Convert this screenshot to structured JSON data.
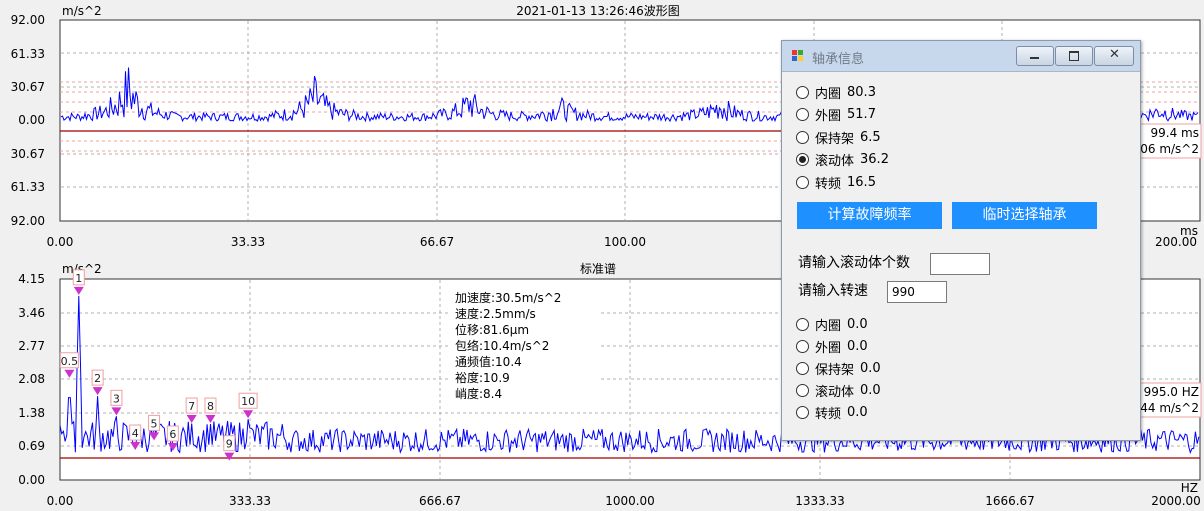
{
  "waveform": {
    "title": "2021-01-13  13:26:46波形图",
    "unit_y": "m/s^2",
    "unit_x": "ms",
    "y_ticks": [
      "92.00",
      "61.33",
      "30.67",
      "0.00",
      "30.67",
      "61.33",
      "92.00"
    ],
    "x_ticks": [
      "0.00",
      "33.33",
      "66.67",
      "100.00",
      "200.00"
    ],
    "cursor_time": "99.4 ms",
    "cursor_value": "06 m/s^2",
    "colors": {
      "signal": "#0000ff",
      "baseline": "#a00000",
      "grid": "#b0b0b0"
    }
  },
  "spectrum": {
    "title": "标准谱",
    "unit_y": "m/s^2",
    "unit_x": "HZ",
    "y_ticks": [
      "4.15",
      "3.46",
      "2.77",
      "2.08",
      "1.38",
      "0.69",
      "0.00"
    ],
    "x_ticks": [
      "0.00",
      "333.33",
      "666.67",
      "1000.00",
      "1333.33",
      "1666.67",
      "2000.00"
    ],
    "cursor_freq": "995.0 HZ",
    "cursor_value": "44 m/s^2",
    "markers": [
      {
        "label": "0.5",
        "freq": 16.5,
        "amp": 2.08
      },
      {
        "label": "1",
        "freq": 33,
        "amp": 3.8
      },
      {
        "label": "2",
        "freq": 66,
        "amp": 1.72
      },
      {
        "label": "3",
        "freq": 99,
        "amp": 1.3
      },
      {
        "label": "4",
        "freq": 132,
        "amp": 0.58
      },
      {
        "label": "5",
        "freq": 165,
        "amp": 0.78
      },
      {
        "label": "6",
        "freq": 198,
        "amp": 0.56
      },
      {
        "label": "7",
        "freq": 231,
        "amp": 1.14
      },
      {
        "label": "8",
        "freq": 264,
        "amp": 1.14
      },
      {
        "label": "9",
        "freq": 297,
        "amp": 0.36
      },
      {
        "label": "10",
        "freq": 330,
        "amp": 1.24
      }
    ],
    "stats": [
      "加速度:30.5m/s^2",
      "速度:2.5mm/s",
      "位移:81.6μm",
      "包络:10.4m/s^2",
      "通频值:10.4",
      "裕度:10.9",
      "峭度:8.4"
    ],
    "colors": {
      "signal": "#0000ff",
      "baseline": "#a00000",
      "marker": "#cc33cc"
    }
  },
  "dialog": {
    "title": "轴承信息",
    "bearing_options": [
      {
        "label": "内圈",
        "value": "80.3",
        "checked": false
      },
      {
        "label": "外圈",
        "value": "51.7",
        "checked": false
      },
      {
        "label": "保持架",
        "value": "6.5",
        "checked": false
      },
      {
        "label": "滚动体",
        "value": "36.2",
        "checked": true
      },
      {
        "label": "转频",
        "value": "16.5",
        "checked": false
      }
    ],
    "calc_button": "计算故障频率",
    "select_button": "临时选择轴承",
    "rolling_count_label": "请输入滚动体个数",
    "rolling_count_value": "",
    "speed_label": "请输入转速",
    "speed_value": "990",
    "temp_options": [
      {
        "label": "内圈",
        "value": "0.0"
      },
      {
        "label": "外圈",
        "value": "0.0"
      },
      {
        "label": "保持架",
        "value": "0.0"
      },
      {
        "label": "滚动体",
        "value": "0.0"
      },
      {
        "label": "转频",
        "value": "0.0"
      }
    ],
    "colors": {
      "button": "#1e90ff",
      "titlebar": "#c8d8ec"
    }
  }
}
